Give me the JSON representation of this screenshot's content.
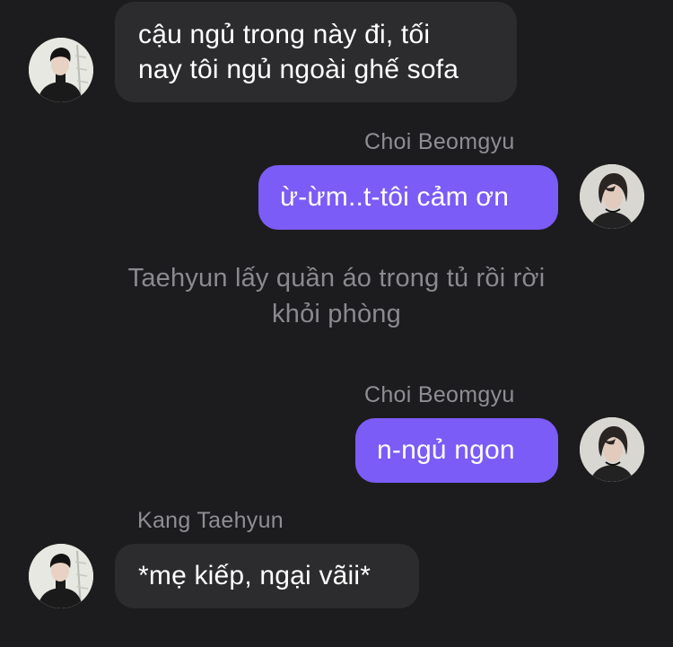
{
  "colors": {
    "background": "#1c1c1e",
    "incoming_bubble": "#2c2c2e",
    "outgoing_bubble": "#7b5cf6",
    "sender_name": "#8e8e93",
    "narration_text": "#8a8a8f"
  },
  "messages": [
    {
      "direction": "incoming",
      "avatar": "avatar-kang-taehyun",
      "lines": [
        "cậu ngủ trong này đi, tối",
        "nay tôi ngủ ngoài ghế sofa"
      ]
    },
    {
      "direction": "outgoing",
      "sender": "Choi Beomgyu",
      "avatar": "avatar-choi-beomgyu",
      "text": "ừ-ừm..t-tôi cảm ơn"
    },
    {
      "type": "narration",
      "lines": [
        "Taehyun lấy quần áo trong tủ rồi rời",
        "khỏi phòng"
      ]
    },
    {
      "direction": "outgoing",
      "sender": "Choi Beomgyu",
      "avatar": "avatar-choi-beomgyu",
      "text": "n-ngủ ngon"
    },
    {
      "direction": "incoming",
      "sender": "Kang Taehyun",
      "avatar": "avatar-kang-taehyun",
      "text": "*mẹ kiếp, ngại vãii*"
    }
  ]
}
